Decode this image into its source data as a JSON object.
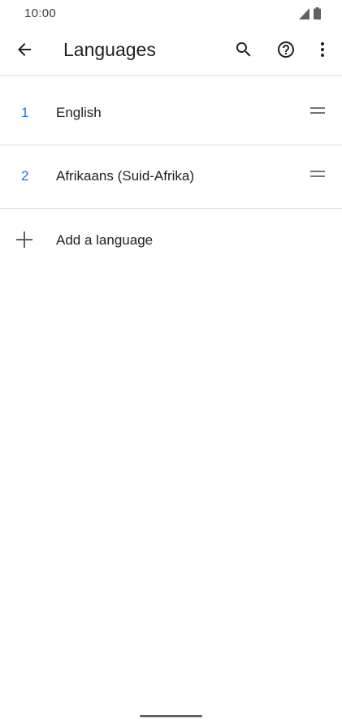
{
  "status_bar": {
    "time": "10:00",
    "icons": [
      "signal-icon",
      "battery-icon"
    ]
  },
  "toolbar": {
    "title": "Languages",
    "icons": [
      "back-arrow-icon",
      "search-icon",
      "help-icon",
      "more-vert-icon"
    ]
  },
  "languages": [
    {
      "number": "1",
      "name": "English"
    },
    {
      "number": "2",
      "name": "Afrikaans (Suid-Afrika)"
    }
  ],
  "add_language": {
    "label": "Add a language",
    "icon": "plus-icon"
  },
  "colors": {
    "accent": "#1a73e8",
    "text_primary": "#202124",
    "divider": "#dadce0",
    "icon": "#5f6368"
  }
}
